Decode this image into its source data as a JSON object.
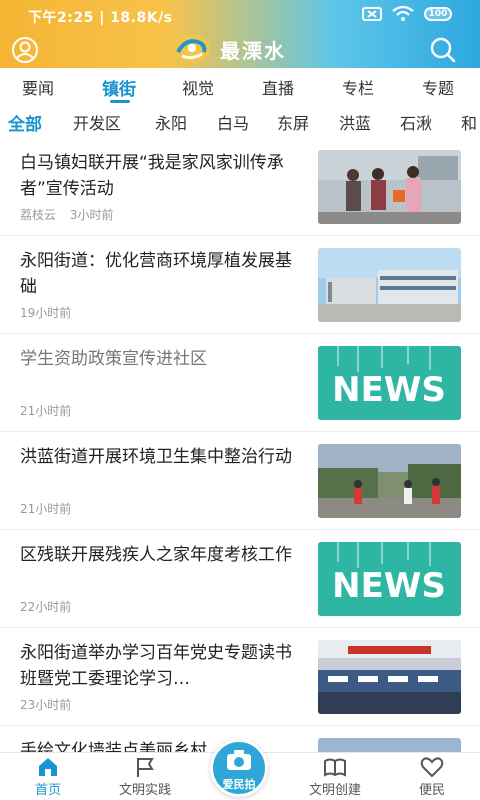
{
  "status": {
    "time_speed": "下午2:25 | 18.8K/s",
    "battery": "100"
  },
  "app": {
    "name": "最溧水"
  },
  "tabs": [
    "要闻",
    "镇街",
    "视觉",
    "直播",
    "专栏",
    "专题"
  ],
  "active_tab": "镇街",
  "subtabs": [
    "全部",
    "开发区",
    "永阳",
    "白马",
    "东屏",
    "洪蓝",
    "石湫",
    "和"
  ],
  "active_subtab": "全部",
  "articles": [
    {
      "title": "白马镇妇联开展“我是家风家训传承者”宣传活动",
      "source": "荔枝云",
      "time": "3小时前",
      "thumb": "photo-people"
    },
    {
      "title": "永阳街道：优化营商环境厚植发展基础",
      "source": "",
      "time": "19小时前",
      "thumb": "photo-building"
    },
    {
      "title": "学生资助政策宣传进社区",
      "source": "",
      "time": "21小时前",
      "thumb": "news"
    },
    {
      "title": "洪蓝街道开展环境卫生集中整治行动",
      "source": "",
      "time": "21小时前",
      "thumb": "photo-cleanup"
    },
    {
      "title": "区残联开展残疾人之家年度考核工作",
      "source": "",
      "time": "22小时前",
      "thumb": "news"
    },
    {
      "title": "永阳街道举办学习百年党史专题读书班暨党工委理论学习…",
      "source": "",
      "time": "23小时前",
      "thumb": "photo-meeting"
    },
    {
      "title": "手绘文化墙装点美丽乡村",
      "source": "",
      "time": "",
      "thumb": "photo"
    }
  ],
  "news_badge_text": "NEWS",
  "bottom_nav": [
    {
      "label": "首页",
      "icon": "home-icon"
    },
    {
      "label": "文明实践",
      "icon": "flag-icon"
    },
    {
      "label": "爱民拍",
      "icon": "camera-icon"
    },
    {
      "label": "文明创建",
      "icon": "book-icon"
    },
    {
      "label": "便民",
      "icon": "heart-icon"
    }
  ],
  "colors": {
    "accent": "#1c95cf",
    "header_left": "#f5b534",
    "header_right": "#2ea7e0",
    "news_tile": "#2fb5a4"
  }
}
